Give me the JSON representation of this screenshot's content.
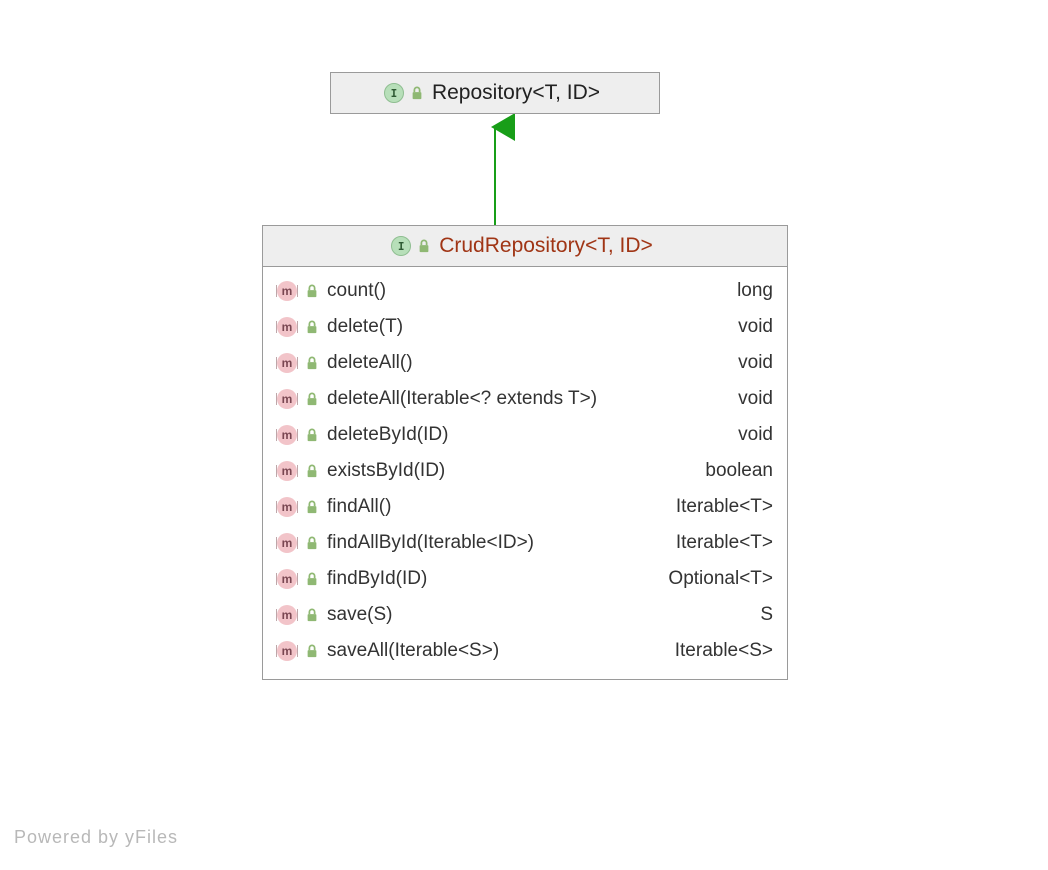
{
  "diagram": {
    "parent": {
      "title": "Repository<T, ID>",
      "type_icon": "I"
    },
    "child": {
      "title": "CrudRepository<T, ID>",
      "type_icon": "I",
      "methods": [
        {
          "name": "count()",
          "returns": "long"
        },
        {
          "name": "delete(T)",
          "returns": "void"
        },
        {
          "name": "deleteAll()",
          "returns": "void"
        },
        {
          "name": "deleteAll(Iterable<? extends T>)",
          "returns": "void"
        },
        {
          "name": "deleteById(ID)",
          "returns": "void"
        },
        {
          "name": "existsById(ID)",
          "returns": "boolean"
        },
        {
          "name": "findAll()",
          "returns": "Iterable<T>"
        },
        {
          "name": "findAllById(Iterable<ID>)",
          "returns": "Iterable<T>"
        },
        {
          "name": "findById(ID)",
          "returns": "Optional<T>"
        },
        {
          "name": "save(S)",
          "returns": "S"
        },
        {
          "name": "saveAll(Iterable<S>)",
          "returns": "Iterable<S>"
        }
      ]
    }
  },
  "footer": "Powered by yFiles"
}
